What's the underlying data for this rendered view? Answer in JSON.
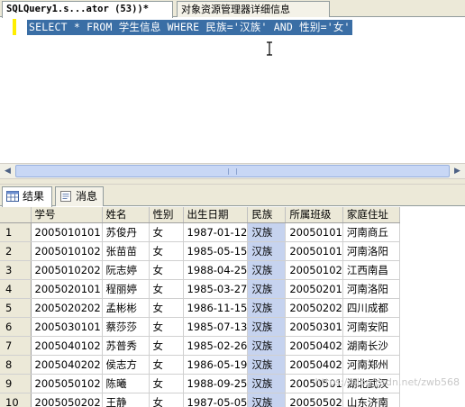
{
  "tabs": {
    "active_label": "SQLQuery1.s...ator (53))*",
    "inactive_label": "对象资源管理器详细信息"
  },
  "editor": {
    "query": "SELECT * FROM 学生信息 WHERE 民族='汉族' AND 性别='女'"
  },
  "result_tabs": {
    "results_label": "结果",
    "messages_label": "消息"
  },
  "grid": {
    "columns": [
      "学号",
      "姓名",
      "性别",
      "出生日期",
      "民族",
      "所属班级",
      "家庭住址"
    ],
    "rows": [
      {
        "num": "1",
        "cells": [
          "2005010101",
          "苏俊丹",
          "女",
          "1987-01-12",
          "汉族",
          "20050101",
          "河南商丘"
        ]
      },
      {
        "num": "2",
        "cells": [
          "2005010102",
          "张苗苗",
          "女",
          "1985-05-15",
          "汉族",
          "20050101",
          "河南洛阳"
        ]
      },
      {
        "num": "3",
        "cells": [
          "2005010202",
          "阮志婷",
          "女",
          "1988-04-25",
          "汉族",
          "20050102",
          "江西南昌"
        ]
      },
      {
        "num": "4",
        "cells": [
          "2005020101",
          "程丽婷",
          "女",
          "1985-03-27",
          "汉族",
          "20050201",
          "河南洛阳"
        ]
      },
      {
        "num": "5",
        "cells": [
          "2005020202",
          "孟彬彬",
          "女",
          "1986-11-15",
          "汉族",
          "20050202",
          "四川成都"
        ]
      },
      {
        "num": "6",
        "cells": [
          "2005030101",
          "蔡莎莎",
          "女",
          "1985-07-13",
          "汉族",
          "20050301",
          "河南安阳"
        ]
      },
      {
        "num": "7",
        "cells": [
          "2005040102",
          "苏普秀",
          "女",
          "1985-02-26",
          "汉族",
          "20050402",
          "湖南长沙"
        ]
      },
      {
        "num": "8",
        "cells": [
          "2005040202",
          "侯志方",
          "女",
          "1986-05-19",
          "汉族",
          "20050402",
          "河南郑州"
        ]
      },
      {
        "num": "9",
        "cells": [
          "2005050102",
          "陈曦",
          "女",
          "1988-09-25",
          "汉族",
          "20050501",
          "湖北武汉"
        ]
      },
      {
        "num": "10",
        "cells": [
          "2005050202",
          "王静",
          "女",
          "1987-05-05",
          "汉族",
          "20050502",
          "山东济南"
        ]
      }
    ]
  },
  "watermark": "https://blog.csdn.net/zwb568"
}
